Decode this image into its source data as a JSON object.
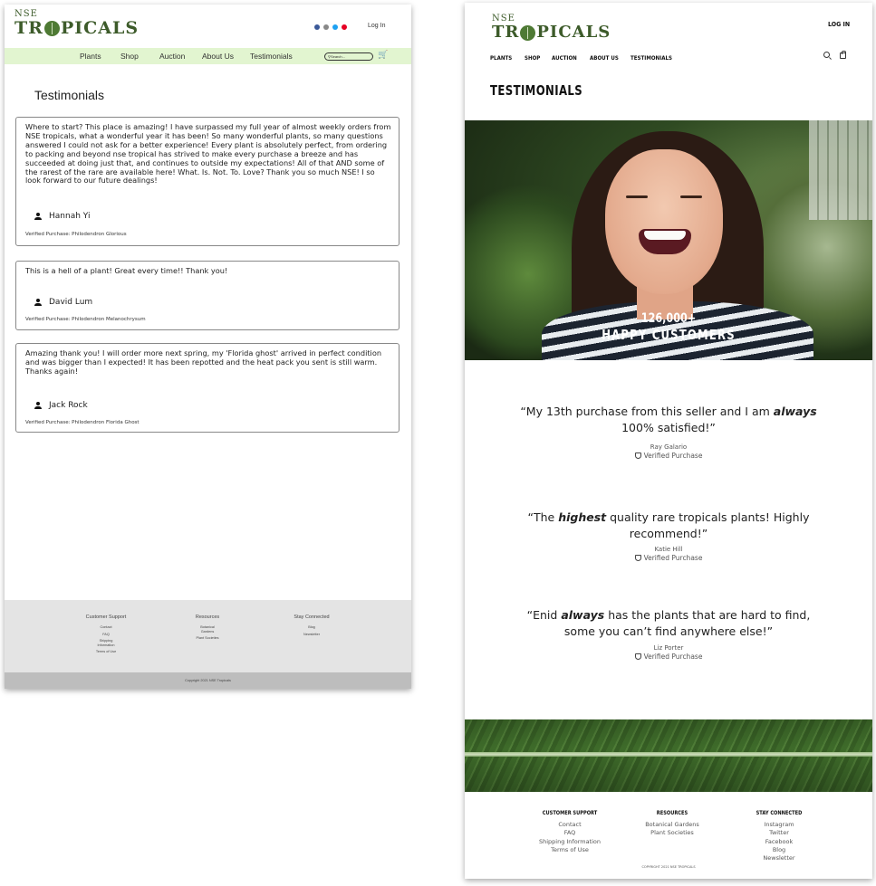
{
  "left": {
    "brand": {
      "top": "NSE",
      "bottom_pre": "TR",
      "bottom_post": "PICALS"
    },
    "header": {
      "login_label": "Log In"
    },
    "nav": {
      "items": [
        "Plants",
        "Shop",
        "Auction",
        "About Us",
        "Testimonials"
      ],
      "search_placeholder": "Search..."
    },
    "social_icons": [
      {
        "name": "facebook-icon",
        "color": "#3b5998"
      },
      {
        "name": "instagram-icon",
        "color": "#888888"
      },
      {
        "name": "twitter-icon",
        "color": "#1da1f2"
      },
      {
        "name": "pinterest-icon",
        "color": "#e60023"
      }
    ],
    "page_title": "Testimonials",
    "testimonials": [
      {
        "text": "Where to start? This place is amazing! I have surpassed my full year of almost weekly orders from NSE tropicals, what a wonderful year it has been! So many wonderful plants, so many questions answered I could not ask for a better experience! Every plant is absolutely perfect, from ordering to packing and beyond nse tropical has strived to make every purchase a breeze and has succeeded at doing just that, and continues to outside my expectations! All of that AND some of the rarest of the rare are available here! What. Is. Not. To. Love? Thank you so much NSE! I so look forward to our future dealings!",
        "author": "Hannah Yi",
        "verified": "Verified Purchase: Philodendron Glorious"
      },
      {
        "text": "This is a hell of a plant! Great every time!! Thank you!",
        "author": "David Lum",
        "verified": "Verified Purchase: Philodendron Melanochrysum"
      },
      {
        "text": "Amazing thank you! I will order more next spring, my 'Florida ghost' arrived in perfect condition and was bigger than I expected! It has been repotted and the heat pack you sent is still warm. Thanks again!",
        "author": "Jack Rock",
        "verified": "Verified Purchase: Philodendron Florida Ghost"
      }
    ],
    "footer": {
      "columns": [
        {
          "heading": "Customer Support",
          "items": [
            "Contact",
            "FAQ",
            "Shipping Information",
            "Terms of Use"
          ]
        },
        {
          "heading": "Resources",
          "items": [
            "Botanical Gardens",
            "Plant Societies"
          ]
        },
        {
          "heading": "Stay Connected",
          "items": [
            "Blog",
            "Newsletter"
          ]
        }
      ],
      "copyright": "Copyright 2021 NSE Tropicals"
    }
  },
  "right": {
    "brand": {
      "top": "NSE",
      "bottom_pre": "TR",
      "bottom_post": "PICALS"
    },
    "header": {
      "login_label": "LOG IN"
    },
    "nav": {
      "items": [
        "PLANTS",
        "SHOP",
        "AUCTION",
        "ABOUT US",
        "TESTIMONIALS"
      ]
    },
    "page_title": "TESTIMONIALS",
    "hero": {
      "count": "126,000+",
      "caption": "HAPPY CUSTOMERS"
    },
    "quotes": [
      {
        "pre": "“My 13th purchase from this seller and I am ",
        "emph": "always",
        "post": " 100% satisfied!”",
        "author": "Ray Galario",
        "verified": "Verified Purchase"
      },
      {
        "pre": "“The ",
        "emph": "highest",
        "post": " quality rare tropicals plants! Highly recommend!”",
        "author": "Katie Hill",
        "verified": "Verified Purchase"
      },
      {
        "pre": "“Enid ",
        "emph": "always",
        "post": " has the plants that are hard to find, some you can’t find anywhere else!”",
        "author": "Liz Porter",
        "verified": "Verified Purchase"
      }
    ],
    "footer": {
      "columns": [
        {
          "heading": "CUSTOMER SUPPORT",
          "items": [
            "Contact",
            "FAQ",
            "Shipping Information",
            "Terms of Use"
          ]
        },
        {
          "heading": "RESOURCES",
          "items": [
            "Botanical Gardens",
            "Plant Societies"
          ]
        },
        {
          "heading": "STAY CONNECTED",
          "items": [
            "Instagram",
            "Twitter",
            "Facebook",
            "Blog",
            "Newsletter"
          ]
        }
      ],
      "copyright": "COPYRIGHT 2021 NSE TROPICALS"
    }
  }
}
